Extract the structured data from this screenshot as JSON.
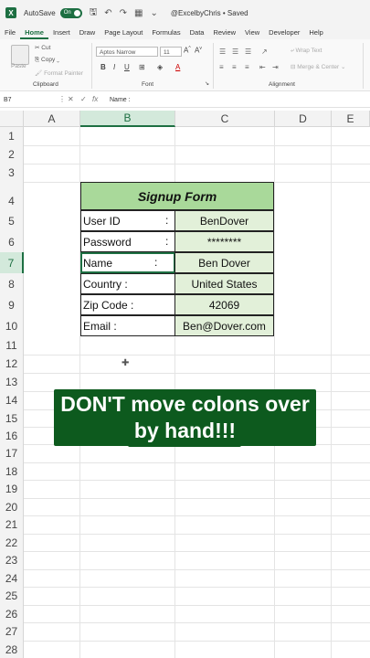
{
  "titlebar": {
    "logo": "X",
    "autosave_label": "AutoSave",
    "autosave_state": "On",
    "title": "@ExcelbyChris • Saved"
  },
  "tabs": [
    {
      "label": "File"
    },
    {
      "label": "Home"
    },
    {
      "label": "Insert"
    },
    {
      "label": "Draw"
    },
    {
      "label": "Page Layout"
    },
    {
      "label": "Formulas"
    },
    {
      "label": "Data"
    },
    {
      "label": "Review"
    },
    {
      "label": "View"
    },
    {
      "label": "Developer"
    },
    {
      "label": "Help"
    }
  ],
  "ribbon": {
    "paste_label": "Paste",
    "cut_label": "Cut",
    "copy_label": "Copy",
    "format_painter_label": "Format Painter",
    "clipboard_group": "Clipboard",
    "font_name": "Aptos Narrow",
    "font_size": "11",
    "font_group": "Font",
    "wrap_text_label": "Wrap Text",
    "merge_center_label": "Merge & Center",
    "alignment_group": "Alignment"
  },
  "formula_bar": {
    "name_box": "B7",
    "content": "Name        :"
  },
  "columns": [
    "A",
    "B",
    "C",
    "D",
    "E"
  ],
  "rows": [
    "1",
    "2",
    "3",
    "4",
    "5",
    "6",
    "7",
    "8",
    "9",
    "10",
    "11",
    "12",
    "13",
    "14",
    "15",
    "16",
    "17",
    "18",
    "19",
    "20",
    "21",
    "22",
    "23",
    "24",
    "25",
    "26",
    "27",
    "28"
  ],
  "form": {
    "title": "Signup Form",
    "fields": [
      {
        "label": "User ID",
        "colon": ":",
        "value": "BenDover"
      },
      {
        "label": "Password",
        "colon": ":",
        "value": "********"
      },
      {
        "label": "Name",
        "colon": ":",
        "value": "Ben Dover"
      },
      {
        "label": "Country :",
        "colon": "",
        "value": "United States"
      },
      {
        "label": "Zip Code :",
        "colon": "",
        "value": "42069"
      },
      {
        "label": "Email :",
        "colon": "",
        "value": "Ben@Dover.com"
      }
    ]
  },
  "caption": {
    "line1": "DON'T move colons over",
    "line2": "by hand!!!"
  },
  "colors": {
    "excel_green": "#1d6f42",
    "title_fill": "#a9d99a",
    "value_fill": "#e2f0d9",
    "caption_bg": "#0d5a1e"
  }
}
